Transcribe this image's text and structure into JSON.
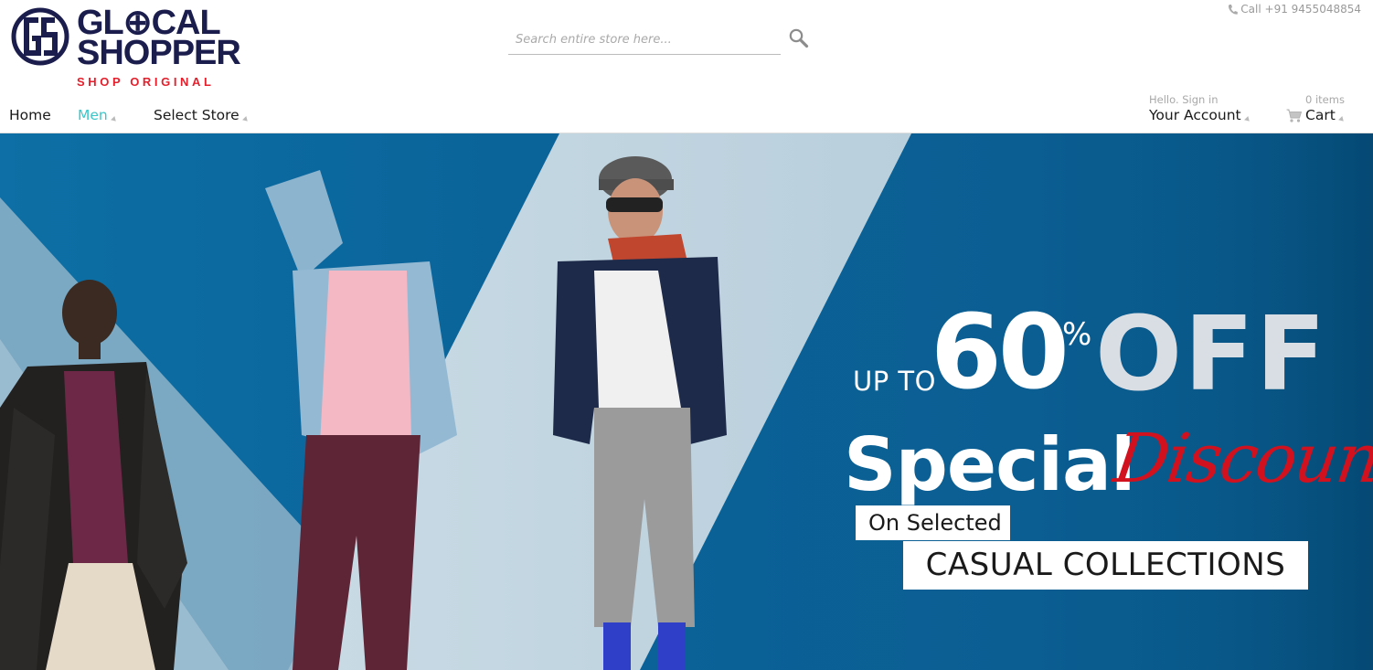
{
  "brand": {
    "line1": "GL⊕CAL",
    "line2": "SHOPPER",
    "tagline": "SHOP ORIGINAL",
    "navy": "#1b1d4d",
    "red": "#e3202c"
  },
  "search": {
    "placeholder": "Search entire store here...",
    "value": "",
    "icon": "magnifier-icon"
  },
  "contact": {
    "phone": "Call +91 9455048854",
    "icon": "phone-icon"
  },
  "nav": {
    "home": "Home",
    "men": "Men",
    "select_store": "Select Store",
    "active_color": "#3cc6c9"
  },
  "account": {
    "greeting": "Hello. Sign in",
    "label": "Your Account"
  },
  "cart": {
    "count": "0 items",
    "label": "Cart",
    "icon": "cart-icon"
  },
  "hero": {
    "up_to": "UP TO",
    "percent": "60",
    "percent_sign": "%",
    "off": "OFF",
    "special": "Special",
    "discounts": "Discounts",
    "on_selected": "On Selected",
    "casual": "CASUAL COLLECTIONS",
    "bg_color": "#0b6399",
    "accent_red": "#d2111f"
  }
}
